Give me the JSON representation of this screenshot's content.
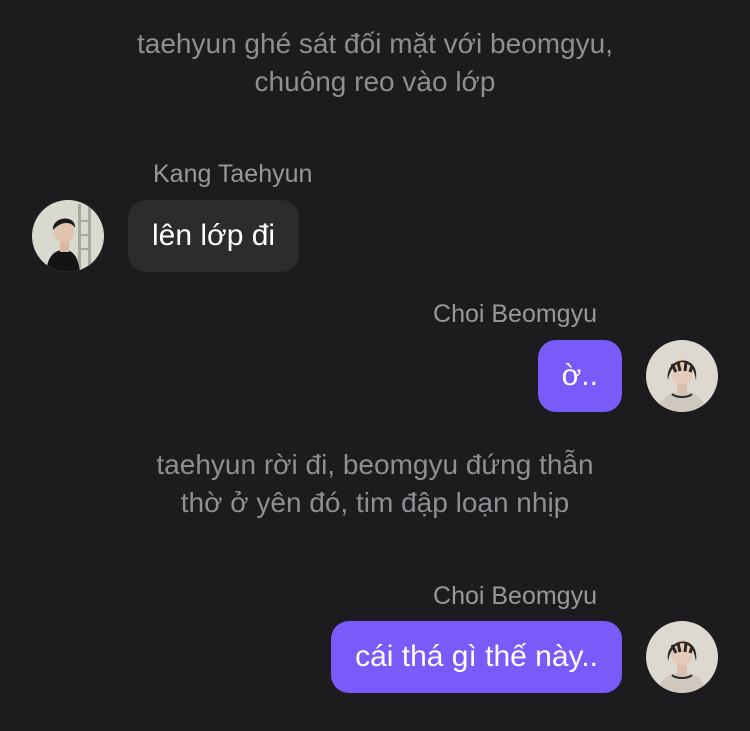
{
  "theme": {
    "background": "#1c1c1e",
    "incoming_bubble": "#2c2c2e",
    "outgoing_bubble": "#7a5af8",
    "narration_text": "#8e8e93",
    "name_text": "#98989d"
  },
  "chat": {
    "narration_1": {
      "line1": "taehyun ghé sát đối mặt với beomgyu,",
      "line2": "chuông reo vào lớp"
    },
    "message_1": {
      "sender": "Kang Taehyun",
      "text": "lên lớp đi",
      "side": "incoming",
      "avatar_icon": "taehyun-avatar"
    },
    "message_2": {
      "sender": "Choi Beomgyu",
      "text": "ờ..",
      "side": "outgoing",
      "avatar_icon": "beomgyu-avatar"
    },
    "narration_2": {
      "line1": "taehyun rời đi, beomgyu đứng thẫn",
      "line2": "thờ ở yên đó, tim đập loạn nhịp"
    },
    "message_3": {
      "sender": "Choi Beomgyu",
      "text": "cái thá gì thế này..",
      "side": "outgoing",
      "avatar_icon": "beomgyu-avatar"
    }
  }
}
